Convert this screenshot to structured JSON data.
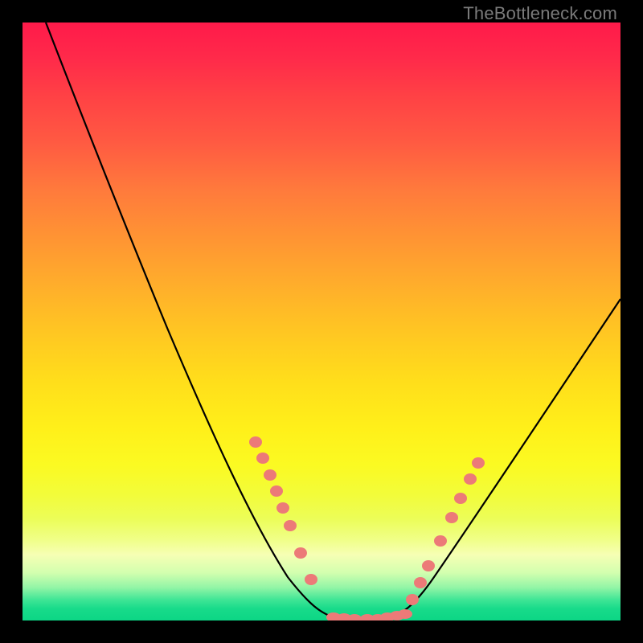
{
  "watermark": "TheBottleneck.com",
  "chart_data": {
    "type": "line",
    "title": "",
    "xlabel": "",
    "ylabel": "",
    "x_range": [
      0,
      100
    ],
    "y_range": [
      0,
      100
    ],
    "grid": false,
    "legend": false,
    "background": "rainbow-gradient-vertical",
    "series": [
      {
        "name": "bottleneck-curve",
        "stroke": "#000000",
        "x": [
          4,
          10,
          15,
          20,
          25,
          30,
          35,
          40,
          45,
          48,
          50,
          52,
          55,
          58,
          60,
          62,
          64,
          70,
          75,
          80,
          85,
          90,
          95,
          100
        ],
        "y": [
          100,
          88,
          78,
          68,
          58,
          48,
          38,
          28,
          14,
          6,
          2,
          0.5,
          0,
          0,
          0.5,
          2,
          4,
          12,
          20,
          28,
          35,
          42,
          48,
          54
        ]
      },
      {
        "name": "highlight-dots-left",
        "type": "scatter",
        "color": "#ec7a78",
        "x": [
          39,
          40.5,
          42,
          43.2,
          44.3,
          45.5,
          47.5,
          49
        ],
        "y": [
          30,
          27,
          23,
          20,
          17,
          14,
          9,
          5
        ]
      },
      {
        "name": "highlight-dots-bottom",
        "type": "scatter",
        "color": "#ec7a78",
        "x": [
          52.5,
          54,
          55.5,
          57.5,
          59,
          60.5,
          62,
          63
        ],
        "y": [
          0.3,
          0.2,
          0.1,
          0.1,
          0.2,
          0.4,
          0.5,
          0.6
        ]
      },
      {
        "name": "highlight-dots-right",
        "type": "scatter",
        "color": "#ec7a78",
        "x": [
          64.5,
          66,
          67.5,
          70,
          72,
          73.5,
          75.2,
          76.5
        ],
        "y": [
          4,
          7,
          10,
          14,
          18,
          21,
          24,
          27
        ]
      }
    ]
  }
}
